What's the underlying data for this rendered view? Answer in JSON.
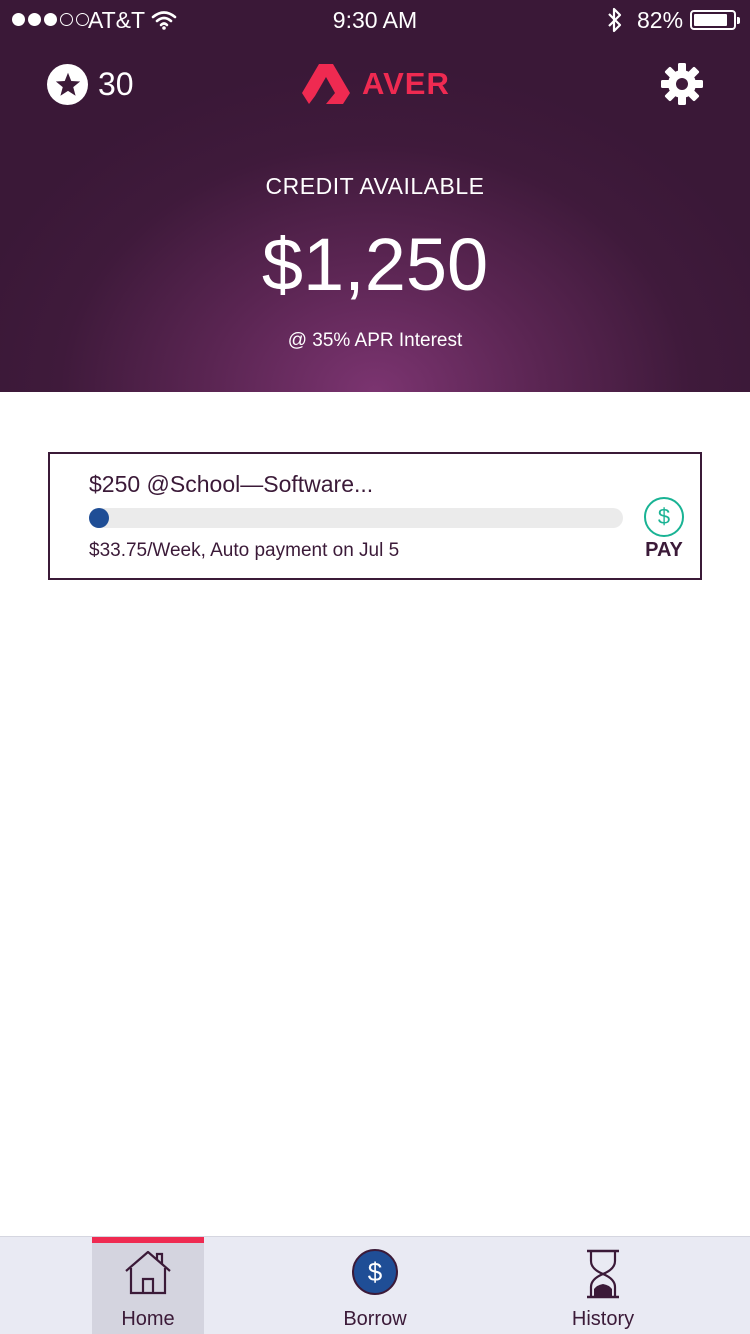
{
  "status_bar": {
    "carrier": "AT&T",
    "signal_bars_filled": 3,
    "signal_bars_total": 5,
    "time": "9:30 AM",
    "battery_percent": "82%",
    "battery_level": 0.82,
    "icons": [
      "wifi-icon",
      "bluetooth-icon",
      "battery-icon"
    ]
  },
  "header": {
    "points": "30",
    "logo_text": "AVER",
    "points_icon": "star-icon",
    "settings_icon": "gear-icon"
  },
  "credit": {
    "label": "CREDIT AVAILABLE",
    "amount": "$1,250",
    "apr": "@ 35% APR Interest"
  },
  "loan": {
    "title": "$250 @School—Software...",
    "progress": 0.0,
    "schedule": "$33.75/Week, Auto payment on Jul 5",
    "pay_symbol": "$",
    "pay_label": "PAY"
  },
  "tabs": [
    {
      "label": "Home",
      "icon": "home-icon",
      "active": true
    },
    {
      "label": "Borrow",
      "icon": "dollar-icon",
      "symbol": "$",
      "active": false
    },
    {
      "label": "History",
      "icon": "hourglass-icon",
      "active": false
    }
  ],
  "colors": {
    "brand": "#ef2a51",
    "hero_dark": "#3f1a3b",
    "hero_glow": "#7b3470",
    "text_dark": "#3b1a38",
    "progress_fill": "#1f4e96",
    "pay_green": "#19b394",
    "tabbar_bg": "#e9eaf3"
  }
}
